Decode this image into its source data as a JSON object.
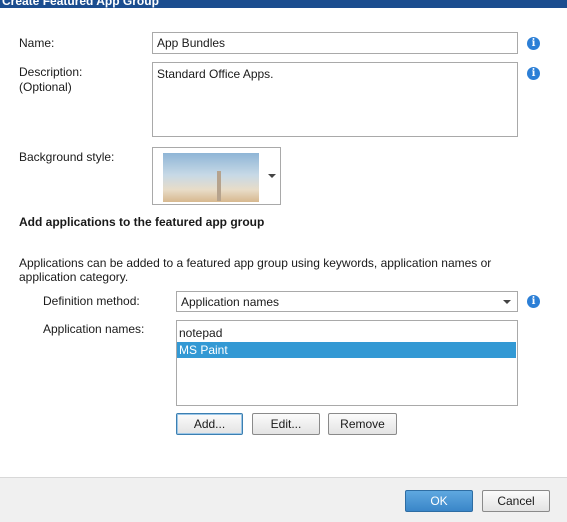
{
  "window": {
    "title": "Create Featured App Group"
  },
  "form": {
    "name_label": "Name:",
    "name_value": "App Bundles",
    "description_label": "Description:",
    "description_optional": "(Optional)",
    "description_value": "Standard Office Apps.",
    "background_label": "Background style:"
  },
  "section": {
    "title": "Add applications to the featured app group",
    "description": "Applications can be added to a featured app group using keywords, application names or application category."
  },
  "definition": {
    "label": "Definition method:",
    "selected": "Application names"
  },
  "applications": {
    "label": "Application names:",
    "items": [
      {
        "name": "notepad",
        "selected": false
      },
      {
        "name": "MS Paint",
        "selected": true
      }
    ]
  },
  "buttons": {
    "add": "Add...",
    "edit": "Edit...",
    "remove": "Remove",
    "ok": "OK",
    "cancel": "Cancel"
  },
  "icons": {
    "info": "info-icon",
    "info_glyph": "i",
    "dropdown": "chevron-down-icon"
  },
  "colors": {
    "titlebar": "#1b4d8f",
    "selection": "#3399d4",
    "info": "#2c7fd6",
    "ok_button": "#3a86c8"
  }
}
